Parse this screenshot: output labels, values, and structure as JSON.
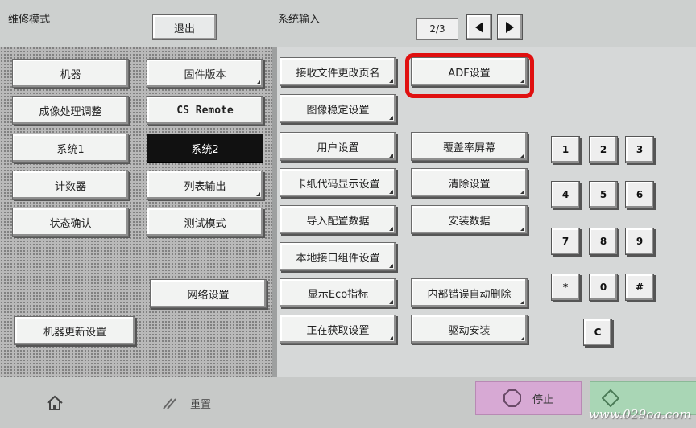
{
  "header": {
    "mode_title": "维修模式",
    "exit_label": "退出",
    "section_title": "系统输入",
    "page_indicator": "2/3"
  },
  "left_column": [
    "机器",
    "成像处理调整",
    "系统1",
    "计数器",
    "状态确认"
  ],
  "left_bottom": "机器更新设置",
  "middle_column": [
    "固件版本",
    "CS Remote",
    "系统2",
    "列表输出",
    "测试模式",
    "网络设置"
  ],
  "selected_item": "系统2",
  "settings_col1": [
    "接收文件更改页名",
    "图像稳定设置",
    "用户设置",
    "卡纸代码显示设置",
    "导入配置数据",
    "本地接口组件设置",
    "显示Eco指标",
    "正在获取设置"
  ],
  "settings_col2": [
    "ADF设置",
    "覆盖率屏幕",
    "清除设置",
    "安装数据",
    "内部错误自动删除",
    "驱动安装"
  ],
  "highlighted_item": "ADF设置",
  "keypad": [
    "1",
    "2",
    "3",
    "4",
    "5",
    "6",
    "7",
    "8",
    "9",
    "*",
    "0",
    "#",
    "C"
  ],
  "footer": {
    "reset_label": "重置",
    "stop_label": "停止",
    "watermark": "www.029oa.com"
  },
  "colors": {
    "highlight": "#e01010",
    "stop_button": "#d7a9d4",
    "start_button": "#a9d6b5",
    "selected_bg": "#111111"
  },
  "icons": [
    "home-icon",
    "reset-icon",
    "stop-icon",
    "start-icon",
    "arrow-left-icon",
    "arrow-right-icon"
  ]
}
